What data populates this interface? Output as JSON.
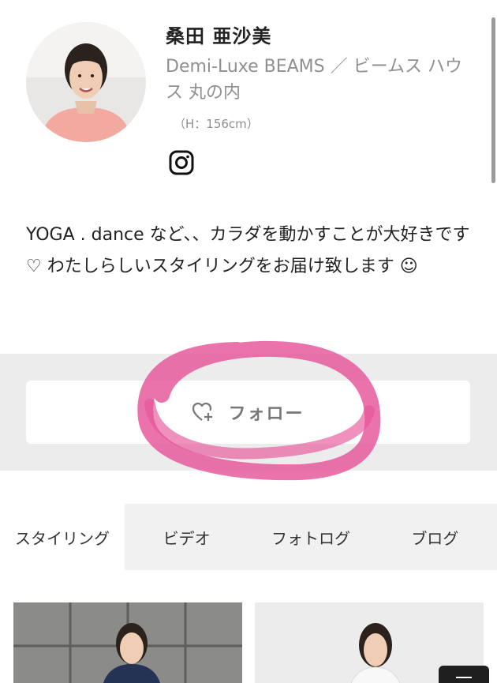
{
  "profile": {
    "name": "桑田 亜沙美",
    "shop": "Demi-Luxe BEAMS ／ ビームス ハウス 丸の内",
    "height": "（H：156cm）",
    "social_icon": "instagram-icon"
  },
  "bio": "YOGA . dance など、、カラダを動かすことが大好きです ♡ わたしらしいスタイリングをお届け致します ☺",
  "follow": {
    "label": "フォロー",
    "icon": "heart-plus-icon"
  },
  "tabs": [
    {
      "label": "スタイリング",
      "active": true
    },
    {
      "label": "ビデオ",
      "active": false
    },
    {
      "label": "フォトログ",
      "active": false
    },
    {
      "label": "ブログ",
      "active": false
    }
  ],
  "colors": {
    "marker": "#e7549a",
    "band": "#ececec",
    "tab_bg": "#f1f1f1"
  }
}
